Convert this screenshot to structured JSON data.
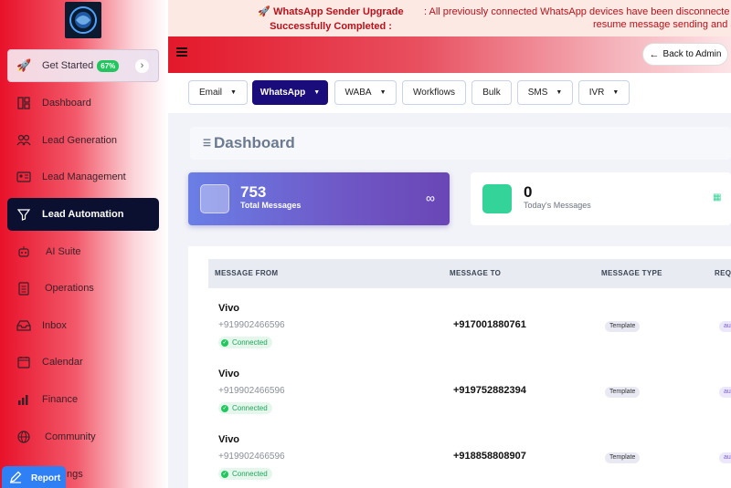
{
  "sidebar": {
    "get_started": {
      "label": "Get Started",
      "badge": "67%"
    },
    "items": [
      {
        "label": "Dashboard",
        "icon": "dashboard-icon"
      },
      {
        "label": "Lead Generation",
        "icon": "users-icon"
      },
      {
        "label": "Lead Management",
        "icon": "id-card-icon"
      },
      {
        "label": "Lead Automation",
        "icon": "funnel-icon",
        "active": true
      },
      {
        "label": "AI Suite",
        "icon": "robot-icon"
      },
      {
        "label": "Operations",
        "icon": "clipboard-icon"
      },
      {
        "label": "Inbox",
        "icon": "inbox-icon"
      },
      {
        "label": "Calendar",
        "icon": "calendar-icon"
      },
      {
        "label": "Finance",
        "icon": "finance-icon"
      },
      {
        "label": "Community",
        "icon": "globe-icon"
      },
      {
        "label": "ngs",
        "icon": "settings-icon"
      }
    ],
    "report_label": "Report"
  },
  "banner": {
    "icon": "rocket-icon",
    "title": "WhatsApp Sender Upgrade Successfully Completed :",
    "message": ": All previously connected WhatsApp devices have been disconnecte",
    "message_line2": "resume message sending and a"
  },
  "header": {
    "back_label": "Back to Admin"
  },
  "tabs": [
    {
      "label": "Email",
      "dropdown": true
    },
    {
      "label": "WhatsApp",
      "dropdown": true,
      "active": true
    },
    {
      "label": "WABA",
      "dropdown": true
    },
    {
      "label": "Workflows",
      "dropdown": false
    },
    {
      "label": "Bulk",
      "dropdown": false
    },
    {
      "label": "SMS",
      "dropdown": true
    },
    {
      "label": "IVR",
      "dropdown": true
    }
  ],
  "dashboard": {
    "title": "Dashboard"
  },
  "stats": [
    {
      "value": "753",
      "label": "Total Messages"
    },
    {
      "value": "0",
      "label": "Today's Messages"
    }
  ],
  "table": {
    "headers": [
      "MESSAGE FROM",
      "MESSAGE TO",
      "MESSAGE TYPE",
      "REQ"
    ],
    "rows": [
      {
        "from": "Vivo",
        "phone": "+919902466596",
        "status": "Connected",
        "to": "+917001880761",
        "type": "Template",
        "req": "au"
      },
      {
        "from": "Vivo",
        "phone": "+919902466596",
        "status": "Connected",
        "to": "+919752882394",
        "type": "Template",
        "req": "au"
      },
      {
        "from": "Vivo",
        "phone": "+919902466596",
        "status": "Connected",
        "to": "+918858808907",
        "type": "Template",
        "req": "au"
      }
    ]
  },
  "colors": {
    "accent_red": "#e3182a",
    "active_nav": "#0b1030",
    "active_tab": "#1a0c7a",
    "report_blue": "#2f7ff5",
    "success_green": "#22c55e"
  }
}
